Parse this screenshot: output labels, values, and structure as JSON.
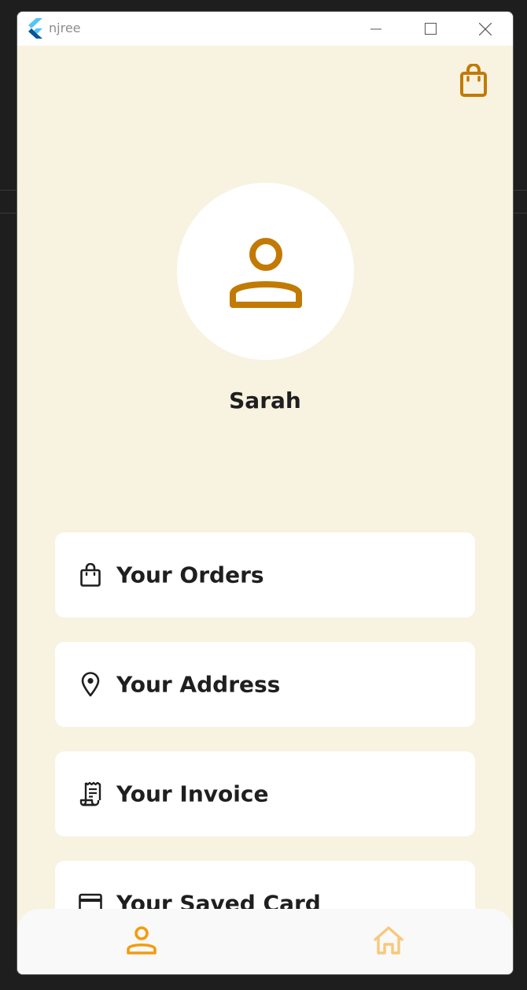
{
  "window": {
    "title": "njree"
  },
  "header": {
    "bag_icon": "shopping-bag-icon"
  },
  "profile": {
    "name": "Sarah",
    "avatar_icon": "person-icon"
  },
  "menu": {
    "items": [
      {
        "label": "Your Orders",
        "icon": "shopping-bag-icon"
      },
      {
        "label": "Your Address",
        "icon": "location-pin-icon"
      },
      {
        "label": "Your Invoice",
        "icon": "receipt-icon"
      },
      {
        "label": "Your Saved Card",
        "icon": "credit-card-icon"
      }
    ]
  },
  "bottom_nav": {
    "items": [
      {
        "icon": "person-icon",
        "active": true
      },
      {
        "icon": "home-icon",
        "active": false
      }
    ]
  },
  "colors": {
    "accent": "#c27a05",
    "nav_active": "#f39c12",
    "nav_inactive": "#f8c87a",
    "background": "#f8f2e1",
    "card": "#ffffff",
    "text": "#1f1f1f"
  }
}
